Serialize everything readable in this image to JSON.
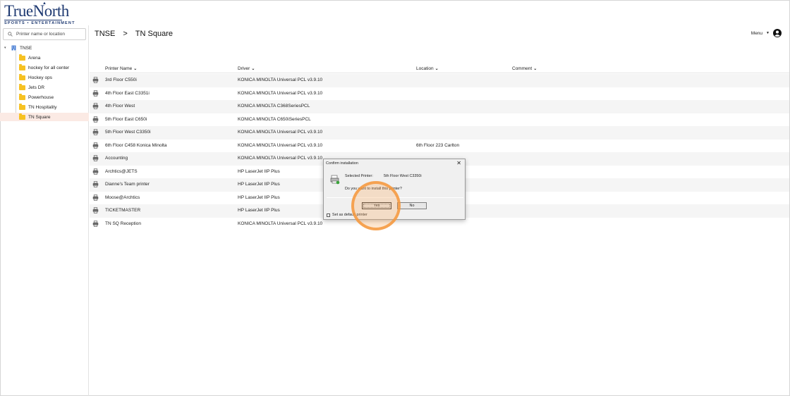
{
  "logo": {
    "brand": "TrueNorth",
    "tagline": "SPORTS • ENTERTAINMENT"
  },
  "search": {
    "placeholder": "Printer name or location"
  },
  "tree": {
    "root": "TNSE",
    "items": [
      {
        "label": "Arena"
      },
      {
        "label": "hockey for all center"
      },
      {
        "label": "Hockey ops"
      },
      {
        "label": "Jets DR"
      },
      {
        "label": "Powerhouse"
      },
      {
        "label": "TN Hospitality"
      },
      {
        "label": "TN Square",
        "selected": true
      }
    ]
  },
  "breadcrumb": {
    "root": "TNSE",
    "separator": ">",
    "current": "TN Square"
  },
  "menu": {
    "label": "Menu"
  },
  "table": {
    "columns": {
      "name": "Printer Name",
      "driver": "Driver",
      "location": "Location",
      "comment": "Comment"
    },
    "rows": [
      {
        "name": "3rd Floor C550i",
        "driver": "KONICA MINOLTA Universal PCL v3.9.10",
        "location": "",
        "comment": ""
      },
      {
        "name": "4th Floor East C3351i",
        "driver": "KONICA MINOLTA Universal PCL v3.9.10",
        "location": "",
        "comment": ""
      },
      {
        "name": "4th Floor West",
        "driver": "KONICA MINOLTA C368SeriesPCL",
        "location": "",
        "comment": ""
      },
      {
        "name": "5th Floor East C650i",
        "driver": "KONICA MINOLTA C650iSeriesPCL",
        "location": "",
        "comment": ""
      },
      {
        "name": "5th Floor West C3350i",
        "driver": "KONICA MINOLTA Universal PCL v3.9.10",
        "location": "",
        "comment": ""
      },
      {
        "name": "6th Floor C458 Konica Minolta",
        "driver": "KONICA MINOLTA Universal PCL v3.9.10",
        "location": "6th Floor 223 Carlton",
        "comment": ""
      },
      {
        "name": "Accounting",
        "driver": "KONICA MINOLTA Universal PCL v3.9.10",
        "location": "",
        "comment": ""
      },
      {
        "name": "Archtics@JETS",
        "driver": "HP LaserJet IIP Plus",
        "location": "",
        "comment": ""
      },
      {
        "name": "Dianne's Team printer",
        "driver": "HP LaserJet IIP Plus",
        "location": "",
        "comment": ""
      },
      {
        "name": "Moose@Archtics",
        "driver": "HP LaserJet IIP Plus",
        "location": "",
        "comment": ""
      },
      {
        "name": "TICKETMASTER",
        "driver": "HP LaserJet IIP Plus",
        "location": "",
        "comment": ""
      },
      {
        "name": "TN SQ Reception",
        "driver": "KONICA MINOLTA Universal PCL v3.9.10",
        "location": "",
        "comment": ""
      }
    ]
  },
  "dialog": {
    "title": "Confirm installation",
    "close": "✕",
    "selected_label": "Selected Printer:",
    "selected_value": "5th Floor West C3350i",
    "question": "Do you want to install this printer?",
    "yes": "Yes",
    "no": "No",
    "default_label": "Set as default printer",
    "default_checked": false
  },
  "colors": {
    "brand": "#1f3a72",
    "folder": "#f6c122",
    "selected_row": "#fbeae4",
    "highlight": "#f5963c"
  }
}
